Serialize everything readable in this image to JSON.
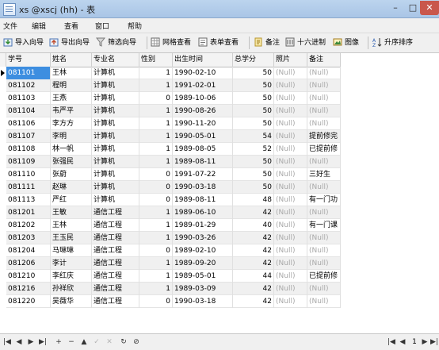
{
  "window": {
    "title": "xs @xscj (hh) - 表"
  },
  "menu": {
    "items": [
      "文件",
      "编辑",
      "查看",
      "窗口",
      "帮助"
    ]
  },
  "toolbar": {
    "import_label": "导入向导",
    "export_label": "导出向导",
    "filter_label": "筛选向导",
    "grid_view_label": "网格查看",
    "form_view_label": "表单查看",
    "memo_label": "备注",
    "hex_label": "十六进制",
    "image_label": "图像",
    "sort_label": "升序排序"
  },
  "table": {
    "columns": [
      "学号",
      "姓名",
      "专业名",
      "性别",
      "出生时间",
      "总学分",
      "照片",
      "备注"
    ],
    "rows": [
      [
        "081101",
        "王林",
        "计算机",
        "1",
        "1990-02-10",
        "50",
        "(Null)",
        "(Null)"
      ],
      [
        "081102",
        "程明",
        "计算机",
        "1",
        "1991-02-01",
        "50",
        "(Null)",
        "(Null)"
      ],
      [
        "081103",
        "王燕",
        "计算机",
        "0",
        "1989-10-06",
        "50",
        "(Null)",
        "(Null)"
      ],
      [
        "081104",
        "韦严平",
        "计算机",
        "1",
        "1990-08-26",
        "50",
        "(Null)",
        "(Null)"
      ],
      [
        "081106",
        "李方方",
        "计算机",
        "1",
        "1990-11-20",
        "50",
        "(Null)",
        "(Null)"
      ],
      [
        "081107",
        "李明",
        "计算机",
        "1",
        "1990-05-01",
        "54",
        "(Null)",
        "提前修完"
      ],
      [
        "081108",
        "林一帆",
        "计算机",
        "1",
        "1989-08-05",
        "52",
        "(Null)",
        "已提前修"
      ],
      [
        "081109",
        "张强民",
        "计算机",
        "1",
        "1989-08-11",
        "50",
        "(Null)",
        "(Null)"
      ],
      [
        "081110",
        "张蔚",
        "计算机",
        "0",
        "1991-07-22",
        "50",
        "(Null)",
        "三好生"
      ],
      [
        "081111",
        "赵琳",
        "计算机",
        "0",
        "1990-03-18",
        "50",
        "(Null)",
        "(Null)"
      ],
      [
        "081113",
        "严红",
        "计算机",
        "0",
        "1989-08-11",
        "48",
        "(Null)",
        "有一门功"
      ],
      [
        "081201",
        "王敏",
        "通信工程",
        "1",
        "1989-06-10",
        "42",
        "(Null)",
        "(Null)"
      ],
      [
        "081202",
        "王林",
        "通信工程",
        "1",
        "1989-01-29",
        "40",
        "(Null)",
        "有一门课"
      ],
      [
        "081203",
        "王玉民",
        "通信工程",
        "1",
        "1990-03-26",
        "42",
        "(Null)",
        "(Null)"
      ],
      [
        "081204",
        "马琳琳",
        "通信工程",
        "0",
        "1989-02-10",
        "42",
        "(Null)",
        "(Null)"
      ],
      [
        "081206",
        "李计",
        "通信工程",
        "1",
        "1989-09-20",
        "42",
        "(Null)",
        "(Null)"
      ],
      [
        "081210",
        "李红庆",
        "通信工程",
        "1",
        "1989-05-01",
        "44",
        "(Null)",
        "已提前修"
      ],
      [
        "081216",
        "孙祥欣",
        "通信工程",
        "1",
        "1989-03-09",
        "42",
        "(Null)",
        "(Null)"
      ],
      [
        "081220",
        "吴薇华",
        "通信工程",
        "0",
        "1990-03-18",
        "42",
        "(Null)",
        "(Null)"
      ]
    ]
  },
  "nav": {
    "page": "1"
  },
  "colors": {
    "selection": "#3d8ee0",
    "alt_row": "#f0f0f0",
    "null_text": "#a8a8a8"
  }
}
